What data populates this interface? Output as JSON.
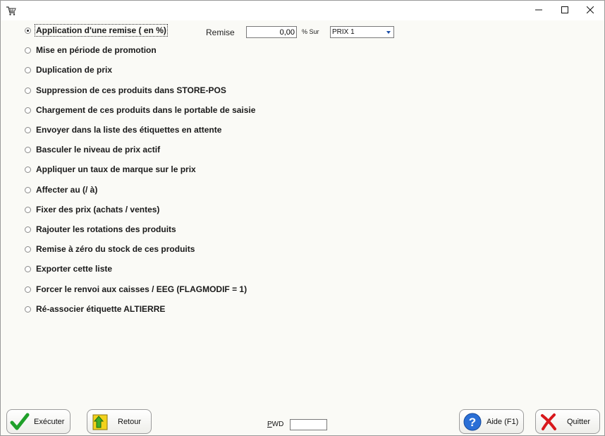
{
  "titlebar": {
    "app_icon": "shopping-cart-icon",
    "minimize_icon": "minimize-icon",
    "maximize_icon": "maximize-icon",
    "close_icon": "close-icon"
  },
  "options": [
    {
      "label": "Application d'une remise ( en %)",
      "checked": true
    },
    {
      "label": "Mise en période de promotion",
      "checked": false
    },
    {
      "label": "Duplication de prix",
      "checked": false
    },
    {
      "label": "Suppression de ces produits dans STORE-POS",
      "checked": false
    },
    {
      "label": "Chargement de ces produits dans le portable de saisie",
      "checked": false
    },
    {
      "label": "Envoyer dans la liste des étiquettes en attente",
      "checked": false
    },
    {
      "label": "Basculer le niveau de prix actif",
      "checked": false
    },
    {
      "label": "Appliquer un taux de marque sur le prix",
      "checked": false
    },
    {
      "label": "Affecter au (/ à)",
      "checked": false
    },
    {
      "label": "Fixer des prix (achats / ventes)",
      "checked": false
    },
    {
      "label": "Rajouter les rotations des produits",
      "checked": false
    },
    {
      "label": "Remise à zéro du stock de ces produits",
      "checked": false
    },
    {
      "label": "Exporter cette liste",
      "checked": false
    },
    {
      "label": "Forcer le renvoi aux caisses / EEG (FLAGMODIF = 1)",
      "checked": false
    },
    {
      "label": "Ré-associer étiquette ALTIERRE",
      "checked": false
    }
  ],
  "remise": {
    "label": "Remise",
    "value": "0,00",
    "sur_label": "% Sur",
    "select_value": "PRIX 1"
  },
  "buttons": {
    "executer": {
      "label": "Exécuter",
      "icon": "checkmark-icon"
    },
    "retour": {
      "label": "Retour",
      "icon": "back-arrow-icon"
    },
    "aide": {
      "label": "Aide (F1)",
      "icon": "help-icon"
    },
    "quitter": {
      "label": "Quitter",
      "icon": "red-x-icon"
    }
  },
  "pwd": {
    "label_first": "P",
    "label_rest": "WD",
    "value": ""
  },
  "colors": {
    "window_bg": "#fafaf6",
    "check_green": "#1fa02a",
    "help_blue": "#2a6fd6",
    "quit_red": "#d8181c",
    "retour_yellow": "#f2d21c"
  }
}
